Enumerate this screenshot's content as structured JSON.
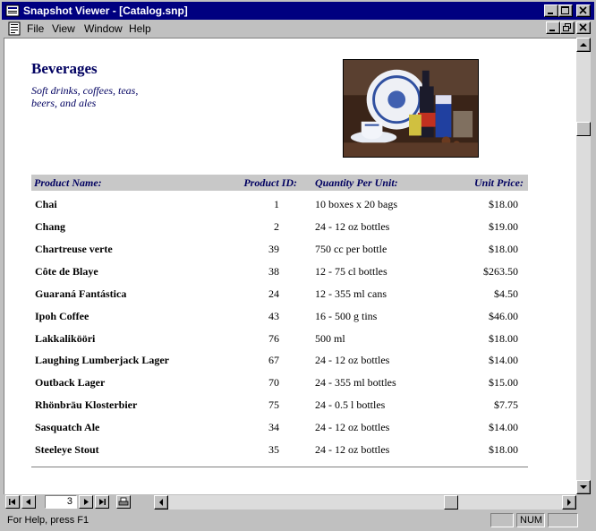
{
  "window": {
    "title": "Snapshot Viewer - [Catalog.snp]"
  },
  "menu": {
    "items": [
      {
        "label": "File"
      },
      {
        "label": "View"
      },
      {
        "label": "Window"
      },
      {
        "label": "Help"
      }
    ]
  },
  "report": {
    "category": "Beverages",
    "description": "Soft drinks, coffees, teas, beers, and ales",
    "columns": {
      "name": "Product Name:",
      "id": "Product ID:",
      "qty": "Quantity Per Unit:",
      "price": "Unit Price:"
    },
    "rows": [
      {
        "name": "Chai",
        "id": "1",
        "qty": "10 boxes x 20 bags",
        "price": "$18.00"
      },
      {
        "name": "Chang",
        "id": "2",
        "qty": "24 - 12 oz bottles",
        "price": "$19.00"
      },
      {
        "name": "Chartreuse verte",
        "id": "39",
        "qty": "750 cc per bottle",
        "price": "$18.00"
      },
      {
        "name": "Côte de Blaye",
        "id": "38",
        "qty": "12 - 75 cl bottles",
        "price": "$263.50"
      },
      {
        "name": "Guaraná Fantástica",
        "id": "24",
        "qty": "12 - 355 ml cans",
        "price": "$4.50"
      },
      {
        "name": "Ipoh Coffee",
        "id": "43",
        "qty": "16 - 500 g tins",
        "price": "$46.00"
      },
      {
        "name": "Lakkalikööri",
        "id": "76",
        "qty": "500 ml",
        "price": "$18.00"
      },
      {
        "name": "Laughing Lumberjack Lager",
        "id": "67",
        "qty": "24 - 12 oz bottles",
        "price": "$14.00"
      },
      {
        "name": "Outback Lager",
        "id": "70",
        "qty": "24 - 355 ml bottles",
        "price": "$15.00"
      },
      {
        "name": "Rhönbräu Klosterbier",
        "id": "75",
        "qty": "24 - 0.5 l bottles",
        "price": "$7.75"
      },
      {
        "name": "Sasquatch Ale",
        "id": "34",
        "qty": "24 - 12 oz bottles",
        "price": "$14.00"
      },
      {
        "name": "Steeleye Stout",
        "id": "35",
        "qty": "24 - 12 oz bottles",
        "price": "$18.00"
      }
    ]
  },
  "navigation": {
    "page": "3"
  },
  "status": {
    "help": "For Help, press F1",
    "num": "NUM"
  },
  "colors": {
    "titlebar": "#000080",
    "chrome": "#c0c0c0",
    "heading_text": "#000060",
    "column_header_bg": "#c8c8c8"
  },
  "icons": [
    "app-icon",
    "document-icon",
    "first-page-icon",
    "prev-page-icon",
    "next-page-icon",
    "last-page-icon",
    "print-icon"
  ]
}
